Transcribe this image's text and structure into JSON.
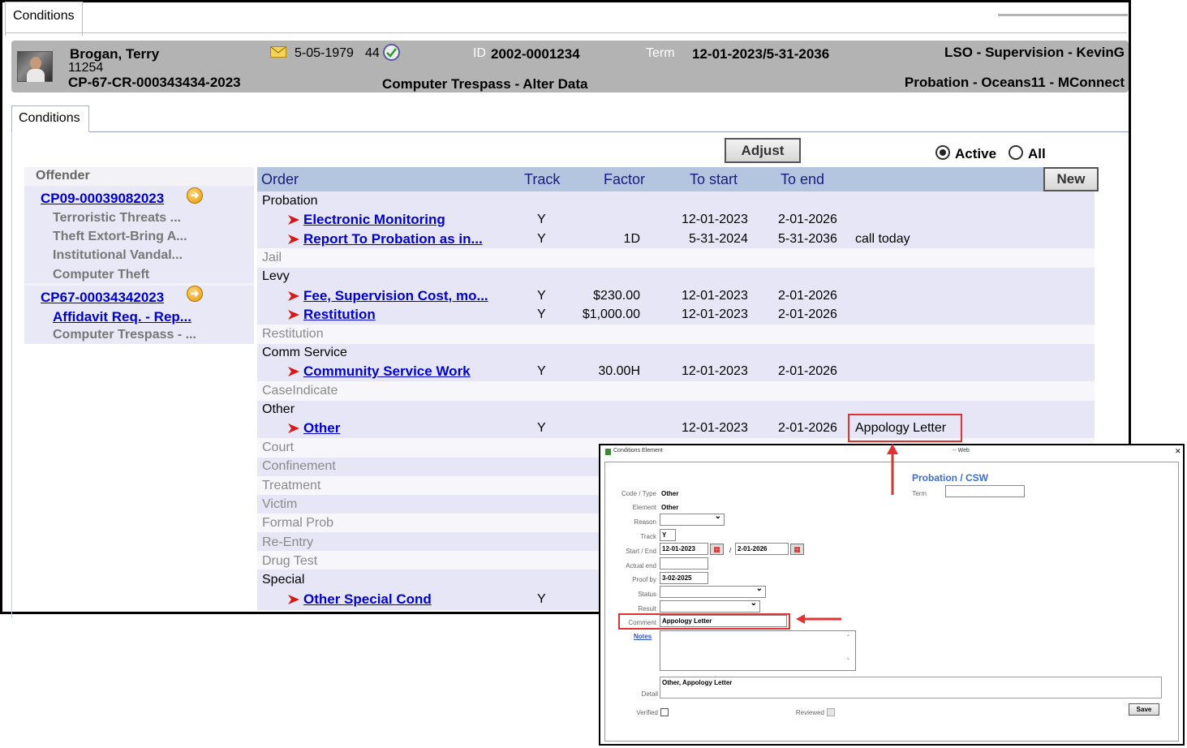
{
  "outer_tab": "Conditions",
  "header": {
    "name": "Brogan, Terry",
    "number": "11254",
    "case": "CP-67-CR-000343434-2023",
    "dob": "5-05-1979",
    "age": "44",
    "id_label": "ID",
    "id_value": "2002-0001234",
    "term_label": "Term",
    "term_value": "12-01-2023/5-31-2036",
    "offense": "Computer Trespass - Alter Data",
    "office": "LSO - Supervision - KevinG",
    "program": "Probation - Oceans11 - MConnect"
  },
  "inner_tab": "Conditions",
  "controls": {
    "adjust": "Adjust",
    "active": "Active",
    "all": "All",
    "new": "New"
  },
  "offender": {
    "heading": "Offender",
    "cases": [
      {
        "id": "CP09-00039082023",
        "items": [
          "Terroristic Threats ...",
          "Theft Extort-Bring A...",
          "Institutional Vandal...",
          "Computer Theft"
        ]
      },
      {
        "id": "CP67-00034342023",
        "items": [
          "Affidavit Req. - Rep...",
          "Computer Trespass - ..."
        ]
      }
    ]
  },
  "columns": [
    "Order",
    "Track",
    "Factor",
    "To start",
    "To end"
  ],
  "rows": {
    "probation": "Probation",
    "em": {
      "name": "Electronic Monitoring",
      "track": "Y",
      "factor": "",
      "start": "12-01-2023",
      "end": "2-01-2026",
      "note": ""
    },
    "rtp": {
      "name": "Report To Probation as in...",
      "track": "Y",
      "factor": "1D",
      "start": "5-31-2024",
      "end": "5-31-2036",
      "note": "call today"
    },
    "jail": "Jail",
    "levy": "Levy",
    "fee": {
      "name": "Fee, Supervision Cost, mo...",
      "track": "Y",
      "factor": "$230.00",
      "start": "12-01-2023",
      "end": "2-01-2026"
    },
    "rest": {
      "name": "Restitution",
      "track": "Y",
      "factor": "$1,000.00",
      "start": "12-01-2023",
      "end": "2-01-2026"
    },
    "restitution": "Restitution",
    "comm": "Comm Service",
    "csw": {
      "name": "Community Service Work",
      "track": "Y",
      "factor": "30.00H",
      "start": "12-01-2023",
      "end": "2-01-2026"
    },
    "caseind": "CaseIndicate",
    "other_cat": "Other",
    "other": {
      "name": "Other",
      "track": "Y",
      "factor": "",
      "start": "12-01-2023",
      "end": "2-01-2026",
      "note": "Appology Letter"
    },
    "court": "Court",
    "confinement": "Confinement",
    "treatment": "Treatment",
    "victim": "Victim",
    "formal": "Formal Prob",
    "reentry": "Re-Entry",
    "drug": "Drug Test",
    "special": "Special",
    "osc": {
      "name": "Other Special Cond",
      "track": "Y"
    }
  },
  "popup": {
    "title": "Conditions Element",
    "web": "-- Web",
    "close": "✕",
    "heading": "Probation / CSW",
    "labels": {
      "code_type": "Code / Type",
      "element": "Element",
      "reason": "Reason",
      "track": "Track",
      "start_end": "Start / End",
      "actual_end": "Actual end",
      "proof_by": "Proof by",
      "status": "Status",
      "result": "Result",
      "comment": "Comment",
      "notes": "Notes",
      "detail": "Detail",
      "verified": "Verified",
      "reviewed": "Reviewed",
      "term": "Term"
    },
    "values": {
      "code_type": "Other",
      "element": "Other",
      "track": "Y",
      "start": "12-01-2023",
      "slash": "/",
      "end": "2-01-2026",
      "proof_by": "3-02-2025",
      "comment": "Appology Letter",
      "detail": "Other,  Appology Letter"
    },
    "save": "Save"
  },
  "colors": {
    "accent": "#0000cc",
    "highlight": "#e03232",
    "header_bg": "#b3b3b3",
    "table_head": "#b4c6df"
  }
}
